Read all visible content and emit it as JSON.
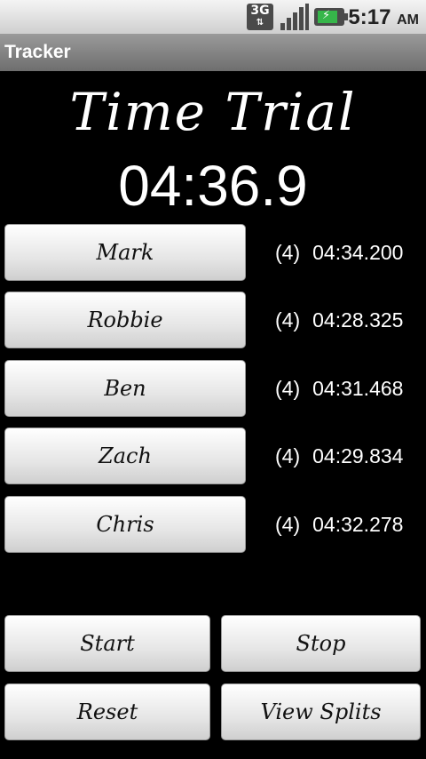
{
  "status_bar": {
    "network": "3G",
    "time": "5:17",
    "ampm": "AM",
    "battery_color": "#36b64a"
  },
  "app": {
    "title": "Tracker"
  },
  "main": {
    "heading": "Time Trial",
    "timer": "04:36.9"
  },
  "runners": [
    {
      "name": "Mark",
      "laps": "(4)",
      "split": "04:34.200"
    },
    {
      "name": "Robbie",
      "laps": "(4)",
      "split": "04:28.325"
    },
    {
      "name": "Ben",
      "laps": "(4)",
      "split": "04:31.468"
    },
    {
      "name": "Zach",
      "laps": "(4)",
      "split": "04:29.834"
    },
    {
      "name": "Chris",
      "laps": "(4)",
      "split": "04:32.278"
    }
  ],
  "controls": {
    "start": "Start",
    "stop": "Stop",
    "reset": "Reset",
    "view_splits": "View Splits"
  }
}
